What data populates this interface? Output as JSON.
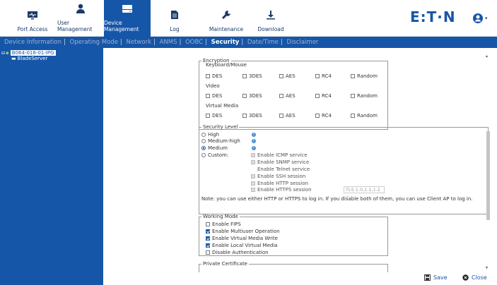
{
  "nav": {
    "items": [
      {
        "label": "Port Access",
        "icon": "monitor-icon"
      },
      {
        "label": "User Management",
        "icon": "user-icon"
      },
      {
        "label": "Device Management",
        "icon": "device-icon"
      },
      {
        "label": "Log",
        "icon": "document-icon"
      },
      {
        "label": "Maintenance",
        "icon": "wrench-icon"
      },
      {
        "label": "Download",
        "icon": "download-icon"
      }
    ],
    "active": "Device Management",
    "brand": "E:T·N"
  },
  "subnav": {
    "items": [
      "Device Information",
      "Operating Mode",
      "Network",
      "ANMS",
      "OOBC",
      "Security",
      "Date/Time",
      "Disclaimer"
    ],
    "current": "Security"
  },
  "tree": {
    "root": "B064-016-01-IPG",
    "child": "BladeServer"
  },
  "encryption": {
    "legend": "Encryption",
    "groups": [
      {
        "title": "Keyboard/Mouse",
        "options": [
          "DES",
          "3DES",
          "AES",
          "RC4",
          "Random"
        ]
      },
      {
        "title": "Video",
        "options": [
          "DES",
          "3DES",
          "AES",
          "RC4",
          "Random"
        ]
      },
      {
        "title": "Virtual Media",
        "options": [
          "DES",
          "3DES",
          "AES",
          "RC4",
          "Random"
        ]
      }
    ]
  },
  "security_level": {
    "legend": "Security Level",
    "levels": [
      "High",
      "Medium-high",
      "Medium",
      "Custom:"
    ],
    "selected": "Medium",
    "custom_options": [
      "Enable ICMP service",
      "Enable SNMP service",
      "Enable Telnet service",
      "Enable SSH session",
      "Enable HTTP session",
      "Enable HTTPS session"
    ],
    "tls_value": "TLS 1.0,1.1,1.2",
    "note": "Note: you can use either HTTP or HTTPS to log in. If you disable both of them, you can use Client AP to log in."
  },
  "working_mode": {
    "legend": "Working Mode",
    "options": [
      {
        "label": "Enable FIPS",
        "checked": false
      },
      {
        "label": "Enable Multiuser Operation",
        "checked": true
      },
      {
        "label": "Enable Virtual Media Write",
        "checked": true
      },
      {
        "label": "Enable Local Virtual Media",
        "checked": true
      },
      {
        "label": "Disable Authentication",
        "checked": false
      }
    ]
  },
  "private_certificate": {
    "legend": "Private Certificate"
  },
  "footer": {
    "save": "Save",
    "close": "Close"
  },
  "colors": {
    "primary": "#1656a8",
    "text": "#333333"
  }
}
